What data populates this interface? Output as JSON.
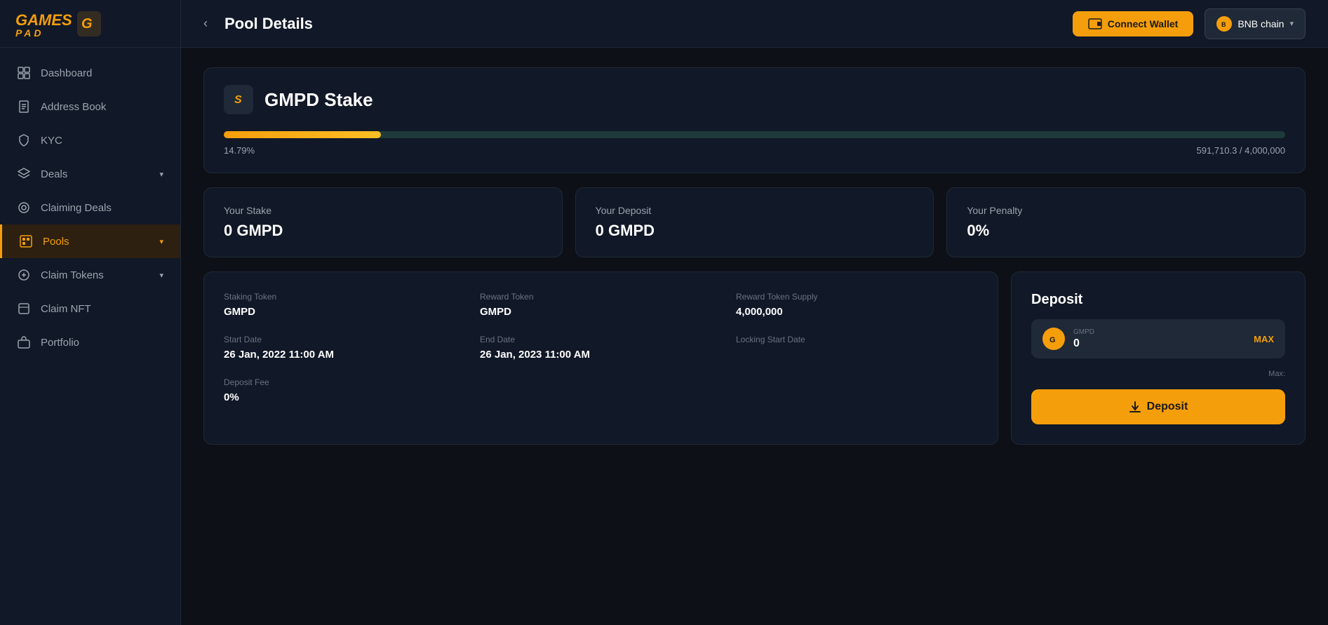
{
  "sidebar": {
    "logo_line1": "GAMES",
    "logo_line2": "PAD",
    "nav_items": [
      {
        "id": "dashboard",
        "label": "Dashboard",
        "icon": "grid"
      },
      {
        "id": "address-book",
        "label": "Address Book",
        "icon": "book"
      },
      {
        "id": "kyc",
        "label": "KYC",
        "icon": "shield"
      },
      {
        "id": "deals",
        "label": "Deals",
        "icon": "layers",
        "has_chevron": true
      },
      {
        "id": "claiming-deals",
        "label": "Claiming Deals",
        "icon": "circle"
      },
      {
        "id": "pools",
        "label": "Pools",
        "icon": "box",
        "active": true,
        "has_chevron": true
      },
      {
        "id": "claim-tokens",
        "label": "Claim Tokens",
        "icon": "circle2",
        "has_chevron": true
      },
      {
        "id": "claim-nft",
        "label": "Claim NFT",
        "icon": "layers2"
      },
      {
        "id": "portfolio",
        "label": "Portfolio",
        "icon": "briefcase"
      }
    ]
  },
  "header": {
    "back_label": "‹",
    "title": "Pool Details",
    "connect_wallet_label": "Connect Wallet",
    "chain_label": "BNB chain",
    "chain_symbol": "B"
  },
  "pool": {
    "icon_symbol": "S",
    "name": "GMPD Stake",
    "progress_pct": "14.79%",
    "progress_pct_number": 14.79,
    "progress_value": "591,710.3 / 4,000,000",
    "your_stake_label": "Your Stake",
    "your_stake_value": "0 GMPD",
    "your_deposit_label": "Your Deposit",
    "your_deposit_value": "0 GMPD",
    "your_penalty_label": "Your Penalty",
    "your_penalty_value": "0%",
    "staking_token_label": "Staking Token",
    "staking_token_value": "GMPD",
    "reward_token_label": "Reward Token",
    "reward_token_value": "GMPD",
    "reward_token_supply_label": "Reward Token Supply",
    "reward_token_supply_value": "4,000,000",
    "start_date_label": "Start Date",
    "start_date_value": "26 Jan, 2022 11:00 AM",
    "end_date_label": "End Date",
    "end_date_value": "26 Jan, 2023 11:00 AM",
    "locking_start_date_label": "Locking Start Date",
    "locking_start_date_value": "",
    "deposit_fee_label": "Deposit Fee",
    "deposit_fee_value": "0%",
    "deposit_section_title": "Deposit",
    "deposit_token_label": "GMPD",
    "deposit_amount": "0",
    "deposit_max_label": "MAX",
    "deposit_max_value_label": "Max:",
    "deposit_button_label": "Deposit"
  }
}
